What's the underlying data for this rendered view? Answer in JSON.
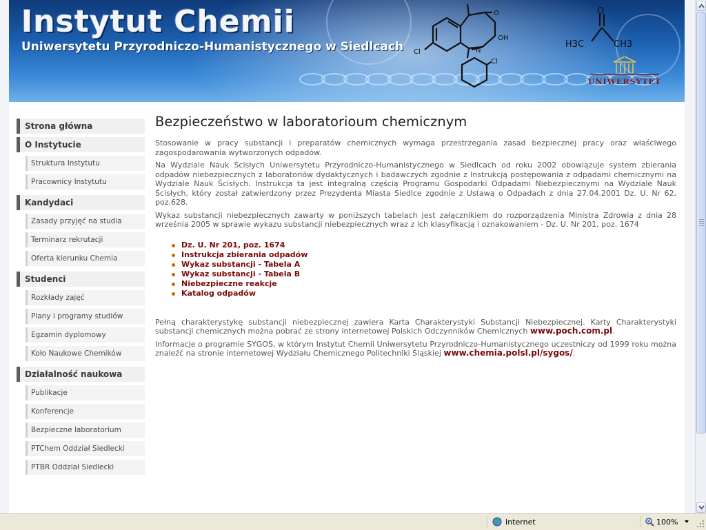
{
  "header": {
    "title": "Instytut Chemii",
    "subtitle": "Uniwersytetu Przyrodniczo-Humanistycznego w Siedlcach",
    "logo_word": "UNIWERSYTET",
    "molecule_labels": [
      "Cl",
      "O",
      "OH",
      "N",
      "Cl"
    ],
    "acetone_labels": [
      "O",
      "H3C",
      "CH3"
    ]
  },
  "sidebar": {
    "sections": [
      {
        "label": "Strona główna",
        "items": []
      },
      {
        "label": "O Instytucie",
        "items": [
          "Struktura Instytutu",
          "Pracownicy Instytutu"
        ]
      },
      {
        "label": "Kandydaci",
        "items": [
          "Zasady przyjęć na studia",
          "Terminarz rekrutacji",
          "Oferta kierunku Chemia"
        ]
      },
      {
        "label": "Studenci",
        "items": [
          "Rozkłady zajęć",
          "Plany i programy studiów",
          "Egzamin dyplomowy",
          "Koło Naukowe Chemików"
        ]
      },
      {
        "label": "Działalność naukowa",
        "items": [
          "Publikacje",
          "Konferencje",
          "Bezpieczne laboratorium",
          "PTChem Oddział Siedlecki",
          "PTBR Oddział Siedlecki"
        ]
      }
    ]
  },
  "main": {
    "title": "Bezpieczeństwo w laboratorioum chemicznym",
    "p1": "Stosowanie w pracy substancji i preparatów chemicznych wymaga przestrzegania zasad bezpiecznej pracy oraz właściwego zagospodarowania wytworzonych odpadów.",
    "p2": "Na Wydziale Nauk Ścisłych Uniwersytetu Przyrodniczo-Humanistycznego w Siedlcach od roku 2002 obowiązuje system zbierania odpadów niebezpiecznych z laboratoriów dydaktycznych i badawczych zgodnie z Instrukcją postępowania z odpadami chemicznymi na Wydziale Nauk Ścisłych. Instrukcja ta jest integralną częścią Programu Gospodarki Odpadami Niebezpiecznymi na Wydziale Nauk Ścisłych, który został zatwierdzony przez Prezydenta Miasta Siedlce zgodnie z Ustawą o Odpadach z dnia 27.04.2001 Dz. U. Nr 62, poz.628.",
    "p3": "Wykaz substancji niebezpiecznych zawarty w poniższych tabelach jest załącznikiem do rozporządzenia Ministra Zdrowia z dnia 28 września 2005 w sprawie wykazu substancji niebezpiecznych wraz z ich klasyfikacją i oznakowaniem - Dz. U. Nr 201, poz. 1674",
    "links": [
      "Dz. U. Nr 201, poz. 1674",
      "Instrukcja zbierania odpadów",
      "Wykaz substancji - Tabela A",
      "Wykaz substancji - Tabela B",
      "Niebezpieczne reakcje",
      "Katalog odpadów"
    ],
    "p4_text": "Pełną charakterystykę substancji niebezpiecznej zawiera Karta Charakterystyki Substancji Niebezpiecznej. Karty Charakterystyki substancji chemicznych można pobrać ze strony internetowej Polskich Odczynników Chemicznych ",
    "p4_link": "www.poch.com.pl",
    "p4_end": ".",
    "p5_text": "Informacje o programie SYGOS, w którym Instytut Chemii Uniwersytetu Przyrodniczo-Humanistycznego uczestniczy od 1999 roku można znaleźć na stronie internetowej Wydziału Chemicznego Politechniki Śląskiej ",
    "p5_link": "www.chemia.polsl.pl/sygos/",
    "p5_end": "."
  },
  "statusbar": {
    "zone": "Internet",
    "zoom": "100%"
  },
  "colors": {
    "link": "#7a0a0a",
    "bullet": "#c46a00",
    "banner_dark": "#0f3a7a",
    "banner_light": "#6fb0e8"
  },
  "icons": [
    "globe-icon",
    "zoom-icon",
    "scroll-up-icon",
    "scroll-down-icon",
    "resize-grip-icon"
  ]
}
